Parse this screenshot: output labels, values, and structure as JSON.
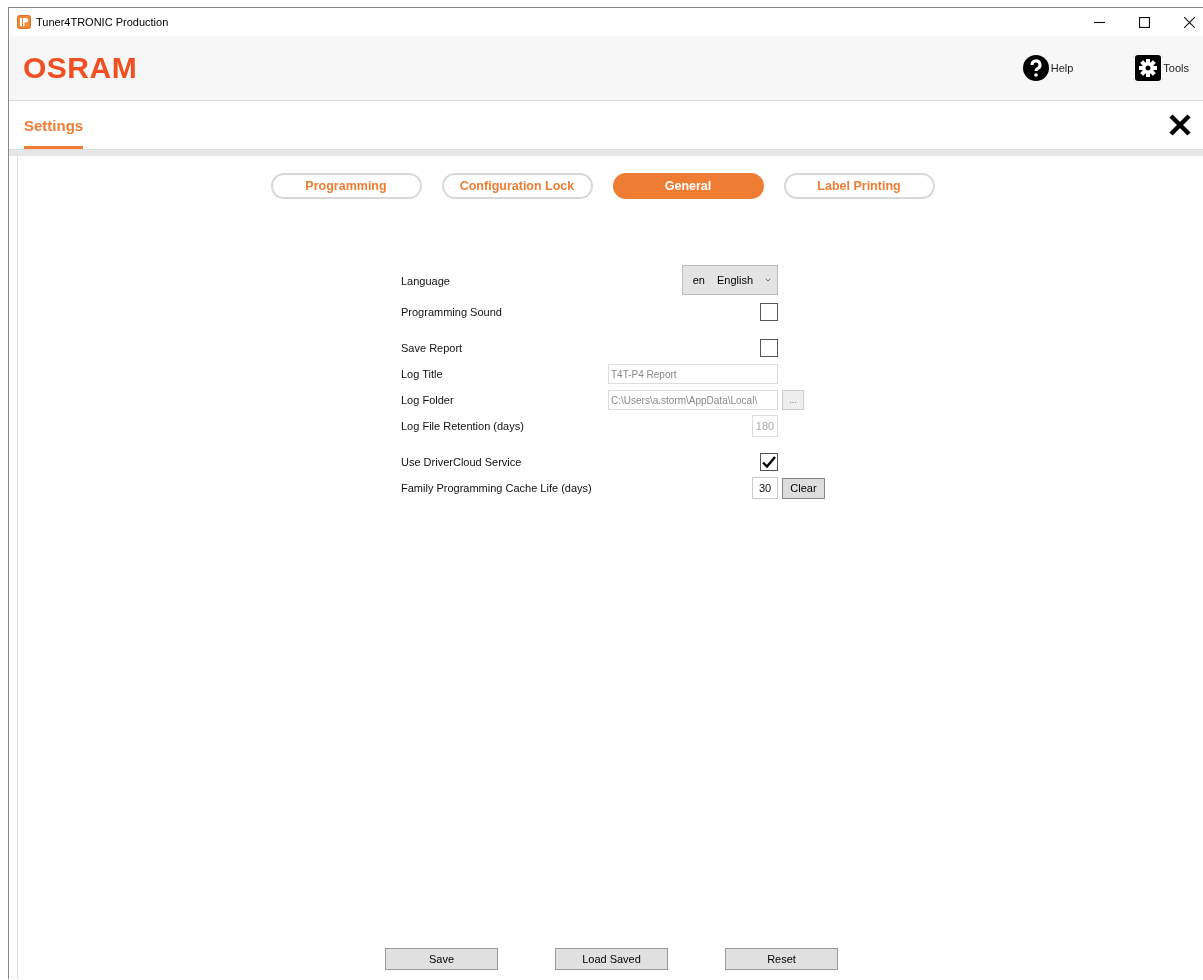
{
  "window": {
    "title": "Tuner4TRONIC Production"
  },
  "header": {
    "logo": "OSRAM",
    "help": "Help",
    "tools": "Tools"
  },
  "page": {
    "title": "Settings"
  },
  "tabs": [
    {
      "label": "Programming",
      "selected": false
    },
    {
      "label": "Configuration Lock",
      "selected": false
    },
    {
      "label": "General",
      "selected": true
    },
    {
      "label": "Label Printing",
      "selected": false
    }
  ],
  "setting_groups": [
    {
      "rows": [
        {
          "kind": "dropdown",
          "label": "Language",
          "code": "en",
          "value": "English"
        },
        {
          "kind": "checkbox",
          "label": "Programming Sound",
          "checked": false
        }
      ]
    },
    {
      "rows": [
        {
          "kind": "checkbox",
          "label": "Save Report",
          "checked": false
        },
        {
          "kind": "text",
          "label": "Log Title",
          "value": "T4T-P4 Report",
          "disabled": true
        },
        {
          "kind": "path",
          "label": "Log Folder",
          "value": "C:\\Users\\a.storm\\AppData\\Local\\",
          "button": "...",
          "disabled": true
        },
        {
          "kind": "number",
          "label": "Log File Retention (days)",
          "value": "180",
          "disabled": true
        }
      ]
    },
    {
      "rows": [
        {
          "kind": "checkbox",
          "label": "Use DriverCloud Service",
          "checked": true
        },
        {
          "kind": "number-button",
          "label": "Family Programming Cache Life (days)",
          "value": "30",
          "disabled": false,
          "button": "Clear"
        }
      ]
    }
  ],
  "buttons": [
    "Save",
    "Load Saved",
    "Reset"
  ]
}
